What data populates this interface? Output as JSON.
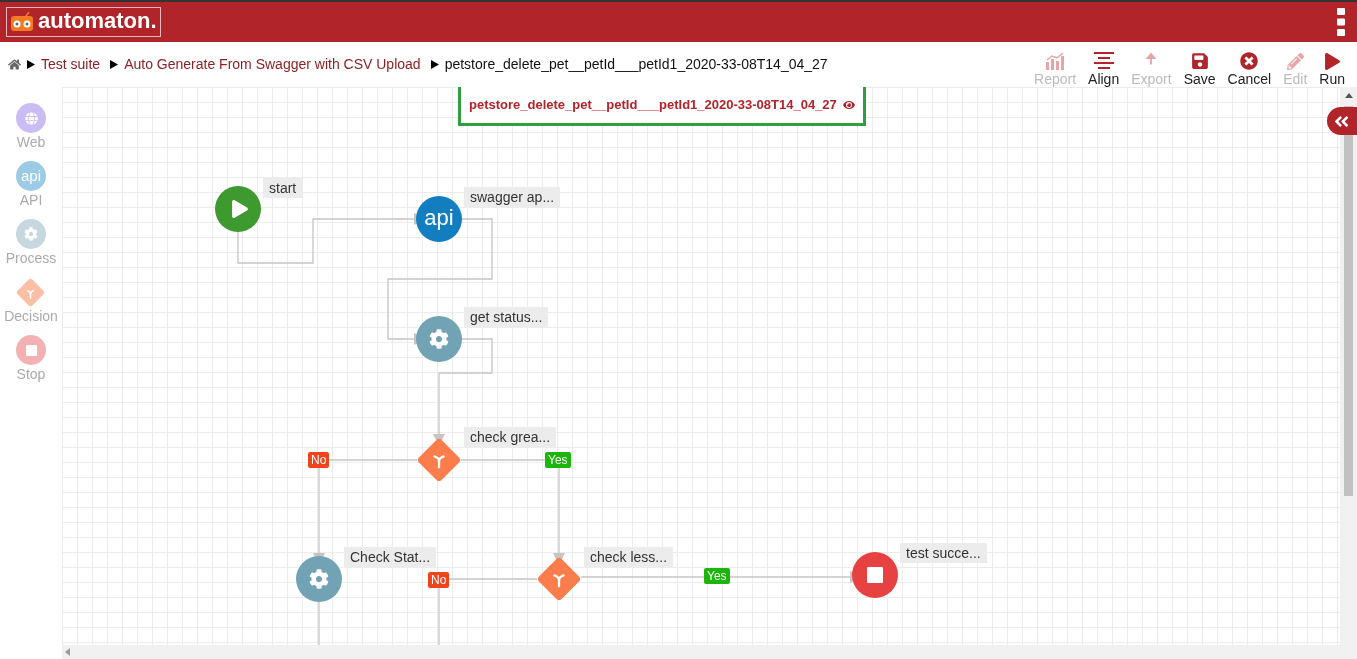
{
  "header": {
    "logo": "automaton."
  },
  "breadcrumb": [
    {
      "label": "Test suite",
      "current": false
    },
    {
      "label": "Auto Generate From Swagger with CSV Upload",
      "current": false
    },
    {
      "label": "petstore_delete_pet__petId___petId1_2020-33-08T14_04_27",
      "current": true
    }
  ],
  "toolbar": [
    {
      "kind": "report",
      "label": "Report",
      "disabled": true
    },
    {
      "kind": "align",
      "label": "Align",
      "disabled": false
    },
    {
      "kind": "export",
      "label": "Export",
      "disabled": true
    },
    {
      "kind": "save",
      "label": "Save",
      "disabled": false
    },
    {
      "kind": "cancel",
      "label": "Cancel",
      "disabled": false
    },
    {
      "kind": "edit",
      "label": "Edit",
      "disabled": true
    },
    {
      "kind": "run",
      "label": "Run",
      "disabled": false
    }
  ],
  "palette": [
    {
      "kind": "web",
      "label": "Web"
    },
    {
      "kind": "api",
      "label": "API",
      "icon_text": "api"
    },
    {
      "kind": "process",
      "label": "Process"
    },
    {
      "kind": "decision",
      "label": "Decision"
    },
    {
      "kind": "stop",
      "label": "Stop"
    }
  ],
  "canvas": {
    "title": "petstore_delete_pet__petId___petId1_2020-33-08T14_04_27",
    "nodes": [
      {
        "kind": "start",
        "label": "start"
      },
      {
        "kind": "api",
        "label": "swagger ap...",
        "icon_text": "api"
      },
      {
        "kind": "process",
        "label": "get status..."
      },
      {
        "kind": "decision",
        "label": "check grea..."
      },
      {
        "kind": "process",
        "label": "Check Stat..."
      },
      {
        "kind": "decision",
        "label": "check less..."
      },
      {
        "kind": "stop",
        "label": "test succe..."
      }
    ],
    "edge_labels": [
      {
        "kind": "no",
        "text": "No"
      },
      {
        "kind": "yes",
        "text": "Yes"
      },
      {
        "kind": "no",
        "text": "No"
      },
      {
        "kind": "yes",
        "text": "Yes"
      }
    ]
  }
}
